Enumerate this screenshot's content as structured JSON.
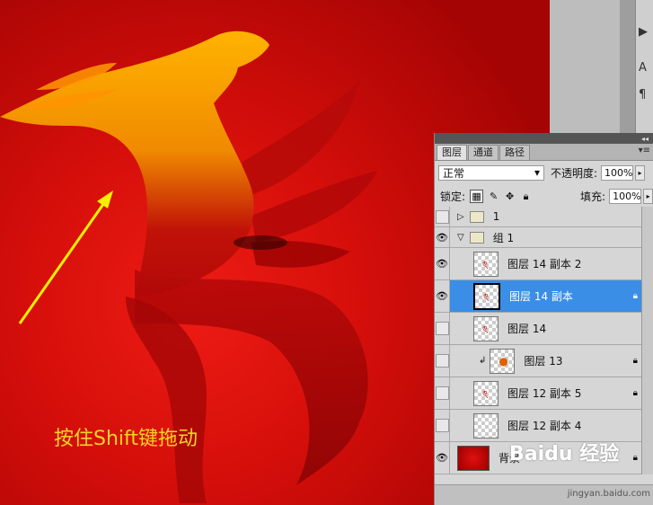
{
  "canvas": {
    "hint_text": "按住Shift键拖动"
  },
  "right_toolbar": {
    "tools": [
      "▶",
      "A",
      "¶"
    ]
  },
  "layers_panel": {
    "tabs": [
      {
        "label": "图层",
        "active": true
      },
      {
        "label": "通道",
        "active": false
      },
      {
        "label": "路径",
        "active": false
      }
    ],
    "blend_mode": "正常",
    "opacity_label": "不透明度:",
    "opacity_value": "100%",
    "lock_label": "锁定:",
    "fill_label": "填充:",
    "fill_value": "100%",
    "layers": [
      {
        "name": "1",
        "type": "group-collapsed",
        "visible": false,
        "locked": false
      },
      {
        "name": "组 1",
        "type": "group-expanded",
        "visible": true,
        "locked": false
      },
      {
        "name": "图层 14 副本 2",
        "type": "layer",
        "visible": true,
        "locked": false,
        "selected": false
      },
      {
        "name": "图层 14 副本",
        "type": "layer",
        "visible": true,
        "locked": true,
        "selected": true
      },
      {
        "name": "图层 14",
        "type": "layer",
        "visible": false,
        "locked": false,
        "selected": false
      },
      {
        "name": "图层 13",
        "type": "clipped-layer",
        "visible": false,
        "locked": true,
        "selected": false
      },
      {
        "name": "图层 12 副本 5",
        "type": "layer",
        "visible": false,
        "locked": true,
        "selected": false
      },
      {
        "name": "图层 12 副本 4",
        "type": "layer",
        "visible": false,
        "locked": false,
        "selected": false
      },
      {
        "name": "背景",
        "type": "background",
        "visible": true,
        "locked": true,
        "selected": false
      }
    ]
  },
  "watermark": {
    "site": "jingyan.baidu.com",
    "brand": "Baidu 经验"
  },
  "colors": {
    "selection": "#3a8ee6",
    "canvas_red": "#d40e0a",
    "hint_yellow": "#f4d423"
  }
}
